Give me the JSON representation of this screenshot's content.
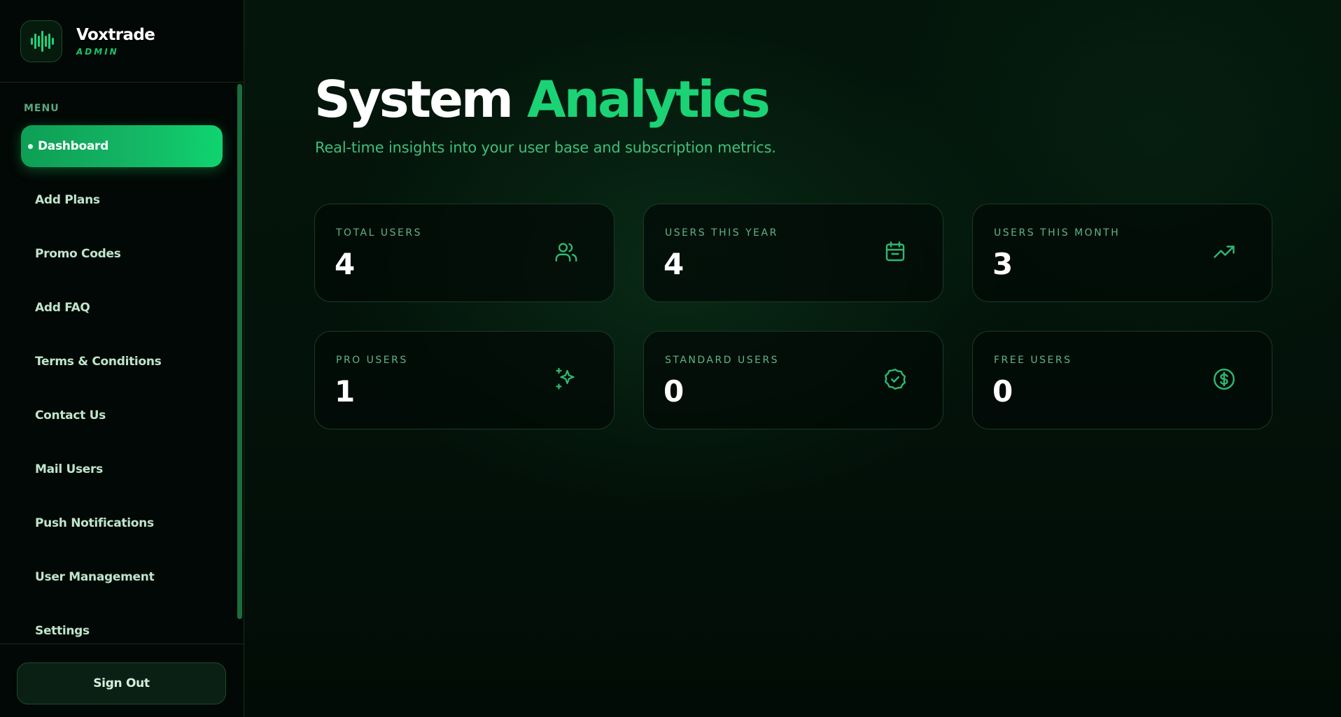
{
  "brand": {
    "name": "Voxtrade",
    "subtitle": "ADMIN",
    "logo_icon": "waveform-icon"
  },
  "sidebar": {
    "menu_label": "MENU",
    "items": [
      {
        "label": "Dashboard",
        "active": true
      },
      {
        "label": "Add Plans"
      },
      {
        "label": "Promo Codes"
      },
      {
        "label": "Add FAQ"
      },
      {
        "label": "Terms & Conditions"
      },
      {
        "label": "Contact Us"
      },
      {
        "label": "Mail Users"
      },
      {
        "label": "Push Notifications"
      },
      {
        "label": "User Management"
      },
      {
        "label": "Settings"
      }
    ],
    "signout_label": "Sign Out"
  },
  "header": {
    "title_part1": "System",
    "title_part2": "Analytics",
    "subtitle": "Real-time insights into your user base and subscription metrics."
  },
  "stats": [
    {
      "label": "TOTAL USERS",
      "value": "4",
      "icon": "users-icon"
    },
    {
      "label": "USERS THIS YEAR",
      "value": "4",
      "icon": "calendar-icon"
    },
    {
      "label": "USERS THIS MONTH",
      "value": "3",
      "icon": "trending-up-icon"
    },
    {
      "label": "PRO USERS",
      "value": "1",
      "icon": "sparkles-icon"
    },
    {
      "label": "STANDARD USERS",
      "value": "0",
      "icon": "badge-check-icon"
    },
    {
      "label": "FREE USERS",
      "value": "0",
      "icon": "dollar-circle-icon"
    }
  ],
  "colors": {
    "accent": "#1bd275",
    "background": "#03120a",
    "sidebar_bg": "#020805",
    "card_border": "#1a3a26",
    "icon": "#2fb874"
  }
}
